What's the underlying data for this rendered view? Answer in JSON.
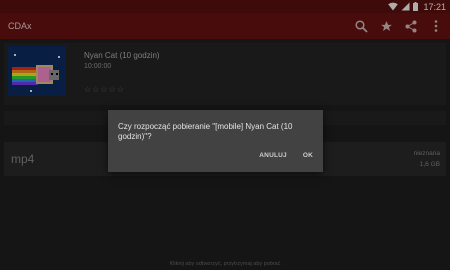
{
  "status_bar": {
    "time": "17:21"
  },
  "app_bar": {
    "title": "CDAx",
    "actions": [
      "search-icon",
      "star-icon",
      "share-icon",
      "more-vert-icon"
    ]
  },
  "video": {
    "title": "Nyan Cat (10 godzin)",
    "duration": "10:00:00",
    "rating_stars": 5,
    "rating_filled": 0
  },
  "format": {
    "label": "mp4",
    "size_status": "nieznana",
    "size": "1,6 GB"
  },
  "footer": {
    "hint": "Kliknij aby odtworzyć, przytrzymaj aby pobrać"
  },
  "dialog": {
    "message": "Czy rozpocząć pobieranie \"[mobile] Nyan Cat (10 godzin)\"?",
    "cancel_label": "ANULUJ",
    "ok_label": "OK"
  },
  "colors": {
    "status_bar": "#5c1010",
    "app_bar": "#6b1212",
    "background": "#1f1f1f",
    "dialog": "#424242"
  }
}
